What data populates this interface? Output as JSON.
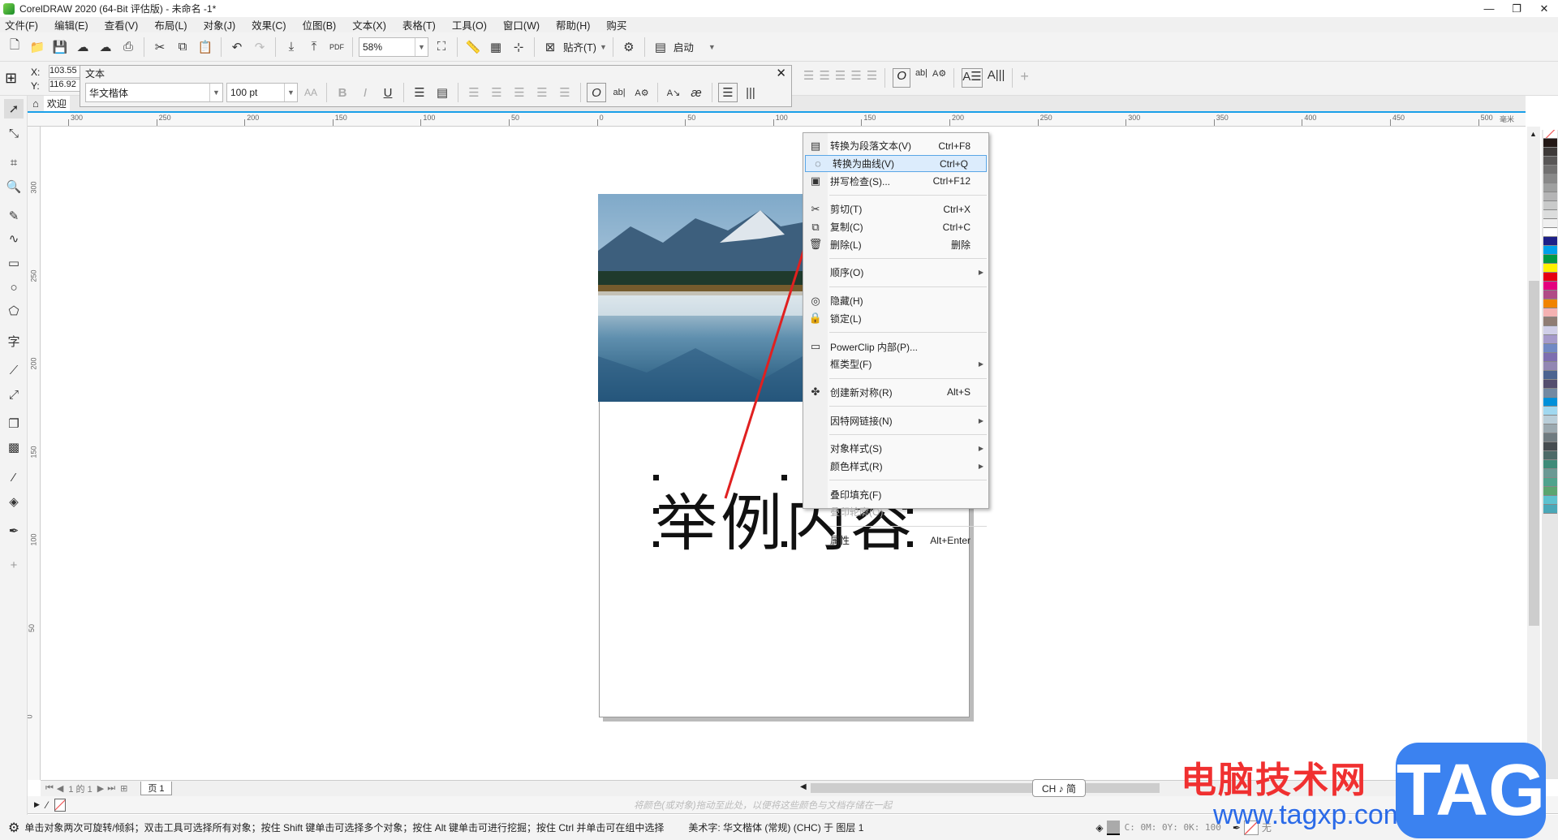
{
  "window": {
    "title": "CorelDRAW 2020 (64-Bit 评估版) - 未命名 -1*"
  },
  "menubar": [
    "文件(F)",
    "编辑(E)",
    "查看(V)",
    "布局(L)",
    "对象(J)",
    "效果(C)",
    "位图(B)",
    "文本(X)",
    "表格(T)",
    "工具(O)",
    "窗口(W)",
    "帮助(H)",
    "购买"
  ],
  "toolbar": {
    "zoom": "58%",
    "snap_label": "贴齐(T)",
    "launch_label": "启动"
  },
  "propbar": {
    "x_label": "X:",
    "x_value": "103.55",
    "y_label": "Y:",
    "y_value": "116.92"
  },
  "text_panel": {
    "title": "文本",
    "font": "华文楷体",
    "size": "100 pt"
  },
  "tabs": {
    "welcome": "欢迎"
  },
  "ruler": {
    "h_labels": [
      "300",
      "250",
      "200",
      "150",
      "100",
      "50",
      "0",
      "50",
      "100",
      "150",
      "200",
      "250",
      "300",
      "350",
      "400",
      "450",
      "500"
    ],
    "unit": "毫米",
    "v_labels": [
      "300",
      "250",
      "200",
      "150",
      "100",
      "50",
      "0"
    ]
  },
  "canvas": {
    "art_text": "举例内容"
  },
  "context_menu": [
    {
      "icon": "para-text-icon",
      "glyph": "▤",
      "label": "转换为段落文本(V)",
      "shortcut": "Ctrl+F8"
    },
    {
      "icon": "curve-icon",
      "glyph": "◌",
      "label": "转换为曲线(V)",
      "shortcut": "Ctrl+Q",
      "highlight": true
    },
    {
      "icon": "spellcheck-icon",
      "glyph": "▣",
      "label": "拼写检查(S)...",
      "shortcut": "Ctrl+F12"
    },
    {
      "sep": true
    },
    {
      "icon": "cut-icon",
      "glyph": "✂",
      "label": "剪切(T)",
      "shortcut": "Ctrl+X"
    },
    {
      "icon": "copy-icon",
      "glyph": "⧉",
      "label": "复制(C)",
      "shortcut": "Ctrl+C"
    },
    {
      "icon": "delete-icon",
      "glyph": "🗑",
      "label": "删除(L)",
      "shortcut": "删除"
    },
    {
      "sep": true
    },
    {
      "label": "顺序(O)",
      "submenu": true
    },
    {
      "sep": true
    },
    {
      "icon": "hide-icon",
      "glyph": "◎",
      "label": "隐藏(H)"
    },
    {
      "icon": "lock-icon",
      "glyph": "🔒",
      "label": "锁定(L)"
    },
    {
      "sep": true
    },
    {
      "icon": "powerclip-icon",
      "glyph": "▭",
      "label": "PowerClip 内部(P)..."
    },
    {
      "label": "框类型(F)",
      "submenu": true
    },
    {
      "sep": true
    },
    {
      "icon": "symbol-icon",
      "glyph": "✤",
      "label": "创建新对称(R)",
      "shortcut": "Alt+S"
    },
    {
      "sep": true
    },
    {
      "label": "因特网链接(N)",
      "submenu": true
    },
    {
      "sep": true
    },
    {
      "label": "对象样式(S)",
      "submenu": true
    },
    {
      "label": "颜色样式(R)",
      "submenu": true
    },
    {
      "sep": true
    },
    {
      "label": "叠印填充(F)"
    },
    {
      "label": "叠印轮廓(O)",
      "disabled": true
    },
    {
      "sep": true
    },
    {
      "label": "属性",
      "shortcut": "Alt+Enter"
    }
  ],
  "palette": [
    "#231815",
    "#3e3a39",
    "#595757",
    "#727171",
    "#898989",
    "#9fa0a0",
    "#b5b5b6",
    "#c9caca",
    "#dcdddd",
    "#efefef",
    "#ffffff",
    "#1d2088",
    "#00a0e9",
    "#009944",
    "#fff100",
    "#e60012",
    "#e4007f",
    "#b04b87",
    "#f08300",
    "#f5b2b2",
    "#8f7d74",
    "#d0cfe8",
    "#a59aca",
    "#7189c4",
    "#7d6eb0",
    "#9287b3",
    "#4c6490",
    "#544e6e",
    "#7289a2",
    "#0090d9",
    "#a0d8f0",
    "#b9ced9",
    "#9ba9b0",
    "#6f7b80",
    "#454c50",
    "#4d6a68",
    "#3e8a78",
    "#6a9994",
    "#4fa38d",
    "#5ba570",
    "#5dc2cf",
    "#4aa8b8"
  ],
  "pagenav": {
    "page_of": "1 的 1",
    "page_tab": "页 1"
  },
  "colorbar": {
    "hint": "将颜色(或对象)拖动至此处，以便将这些颜色与文档存储在一起"
  },
  "status": {
    "hint": "单击对象两次可旋转/倾斜；双击工具可选择所有对象；按住 Shift 键单击可选择多个对象；按住 Alt 键单击可进行挖掘；按住 Ctrl 并单击可在组中选择",
    "object_info": "美术字: 华文楷体 (常规) (CHC) 于 图层 1",
    "fill": "C: 0M: 0Y: 0K: 100",
    "outline": "无"
  },
  "ime": "CH ♪ 简",
  "watermark": {
    "site_name": "电脑技术网",
    "url": "www.tagxp.com",
    "logo": "TAG"
  },
  "colors": {
    "accent": "#1aa0e8",
    "menu_highlight": "#dcecfc",
    "arrow": "#e02020"
  }
}
